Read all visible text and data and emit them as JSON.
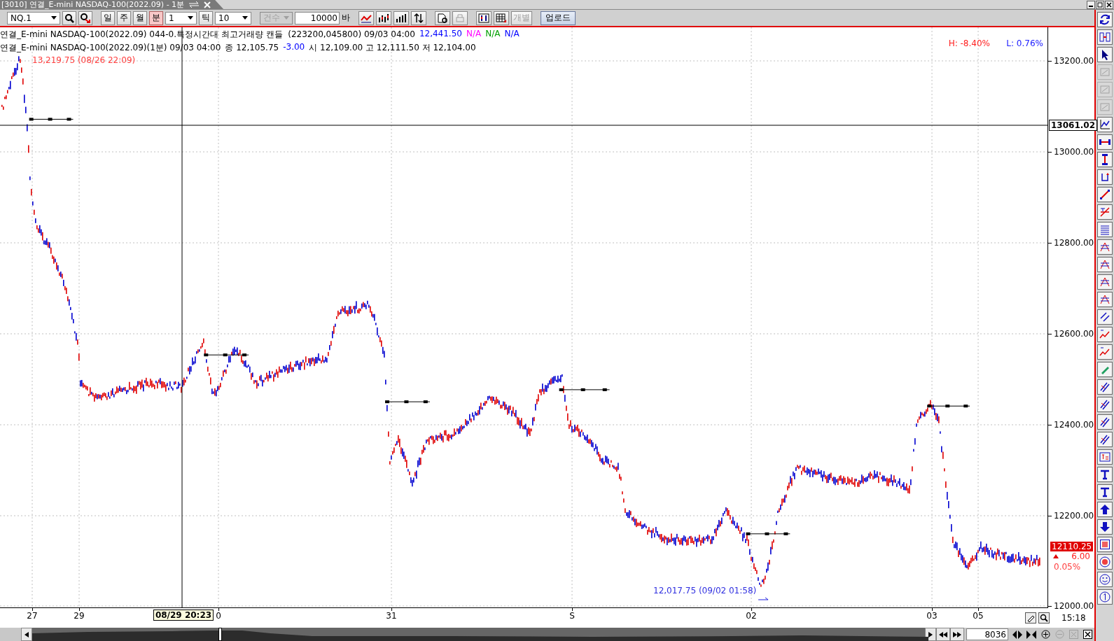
{
  "window": {
    "title": "[3010] 연결_E-mini NASDAQ-100(2022.09) - 1분"
  },
  "toolbar": {
    "symbol": "NQ.1",
    "periods": [
      {
        "label": "일",
        "selected": false
      },
      {
        "label": "주",
        "selected": false
      },
      {
        "label": "월",
        "selected": false
      },
      {
        "label": "분",
        "selected": true
      }
    ],
    "interval": "1",
    "tick_button": "틱",
    "tick_value": "10",
    "count_mode": {
      "label": "건수",
      "disabled": true
    },
    "bar_count": "10000",
    "bar_unit": "바",
    "print": {
      "disabled": true
    },
    "separate": {
      "label": "개별",
      "disabled": true
    },
    "upload": "업로드"
  },
  "legend": [
    {
      "parts": [
        {
          "text": "연결_E-mini NASDAQ-100(2022.09) 044-0.특정시간대 최고거래량 캔들  (223200,045800) 09/03 04:00",
          "color": "#000000"
        },
        {
          "text": "12,441.50",
          "color": "#0000ff"
        },
        {
          "text": "N/A",
          "color": "#ff00ff"
        },
        {
          "text": "N/A",
          "color": "#00a000"
        },
        {
          "text": "N/A",
          "color": "#0000ff"
        }
      ]
    },
    {
      "parts": [
        {
          "text": "연결_E-mini NASDAQ-100(2022.09)(1분) 09/03 04:00",
          "color": "#000000"
        },
        {
          "text": "종 12,105.75",
          "color": "#000000"
        },
        {
          "text": "-3.00",
          "color": "#0000ff"
        },
        {
          "text": "시 12,109.00 고 12,111.50 저 12,104.00",
          "color": "#000000"
        }
      ]
    }
  ],
  "chart": {
    "high_label": "13,219.75 (08/26 22:09)",
    "low_label": "12,017.75 (09/02 01:58)",
    "h_change": "H: -8.40%",
    "l_change": "L: 0.76%",
    "price_ticks": [
      "13200.00",
      "13000.00",
      "12800.00",
      "12600.00",
      "12400.00",
      "12200.00",
      "12000.00"
    ],
    "crosshair_price": "13061.02",
    "crosshair_time": "08/29 20:23",
    "last_price": "12110.25",
    "change": "6.00",
    "change_pct": "0.05%",
    "date_labels": [
      "27",
      "29",
      "0",
      "31",
      "S",
      "02",
      "03",
      "05"
    ],
    "time": "15:18"
  },
  "scroll": {
    "page_value": "8036",
    "zoom_out": {
      "disabled": true
    },
    "fit": {
      "disabled": true
    }
  },
  "drawing_tools": [
    {
      "disabled": false
    },
    {
      "disabled": false
    },
    {
      "disabled": false
    },
    {
      "disabled": true
    },
    {
      "disabled": true
    },
    {
      "disabled": true
    },
    {
      "disabled": false
    },
    {
      "disabled": false
    },
    {
      "disabled": false
    },
    {
      "disabled": false
    },
    {
      "disabled": false
    },
    {
      "disabled": false
    },
    {
      "disabled": false
    },
    {
      "disabled": false
    },
    {
      "disabled": false
    },
    {
      "disabled": false
    },
    {
      "disabled": false
    },
    {
      "disabled": false
    },
    {
      "disabled": false
    },
    {
      "disabled": false
    },
    {
      "disabled": false
    },
    {
      "disabled": false
    },
    {
      "disabled": false
    },
    {
      "disabled": false
    },
    {
      "disabled": false
    },
    {
      "disabled": false
    },
    {
      "disabled": false
    },
    {
      "disabled": false
    },
    {
      "disabled": false
    },
    {
      "disabled": false
    },
    {
      "disabled": false
    },
    {
      "disabled": false
    },
    {
      "disabled": false
    },
    {
      "disabled": false
    }
  ]
}
